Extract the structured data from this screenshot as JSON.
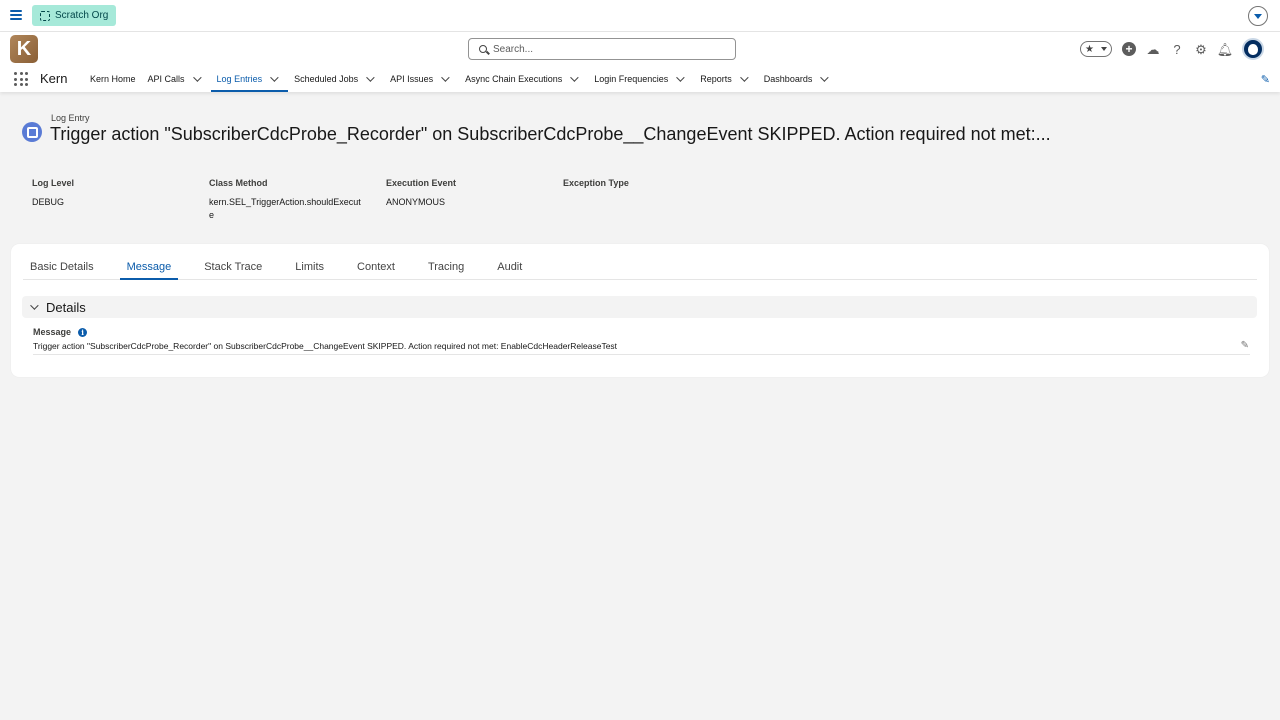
{
  "org_bar": {
    "badge_label": "Scratch Org"
  },
  "header": {
    "logo_letter": "K",
    "search_placeholder": "Search...",
    "icons": [
      "favorites-star-icon",
      "add-icon",
      "trailhead-icon",
      "help-icon",
      "setup-gear-icon",
      "notifications-bell-icon",
      "user-avatar"
    ]
  },
  "nav": {
    "app_name": "Kern",
    "items": [
      {
        "label": "Kern Home",
        "has_menu": false
      },
      {
        "label": "API Calls",
        "has_menu": true
      },
      {
        "label": "Log Entries",
        "has_menu": true,
        "active": true
      },
      {
        "label": "Scheduled Jobs",
        "has_menu": true
      },
      {
        "label": "API Issues",
        "has_menu": true
      },
      {
        "label": "Async Chain Executions",
        "has_menu": true
      },
      {
        "label": "Login Frequencies",
        "has_menu": true
      },
      {
        "label": "Reports",
        "has_menu": true
      },
      {
        "label": "Dashboards",
        "has_menu": true
      }
    ]
  },
  "record": {
    "type_label": "Log Entry",
    "title": "Trigger action \"SubscriberCdcProbe_Recorder\" on SubscriberCdcProbe__ChangeEvent SKIPPED. Action required not met:...",
    "highlights": [
      {
        "label": "Log Level",
        "value": "DEBUG"
      },
      {
        "label": "Class Method",
        "value": "kern.SEL_TriggerAction.shouldExecute"
      },
      {
        "label": "Execution Event",
        "value": "ANONYMOUS"
      },
      {
        "label": "Exception Type",
        "value": ""
      }
    ]
  },
  "tabs": [
    "Basic Details",
    "Message",
    "Stack Trace",
    "Limits",
    "Context",
    "Tracing",
    "Audit"
  ],
  "active_tab": "Message",
  "details": {
    "section_title": "Details",
    "field_label": "Message",
    "field_value": "Trigger action \"SubscriberCdcProbe_Recorder\" on SubscriberCdcProbe__ChangeEvent SKIPPED. Action required not met: EnableCdcHeaderReleaseTest"
  },
  "colors": {
    "brand_blue": "#0b5cab",
    "scratch_badge": "#a6e9d9",
    "record_icon": "#5a7bd5"
  }
}
